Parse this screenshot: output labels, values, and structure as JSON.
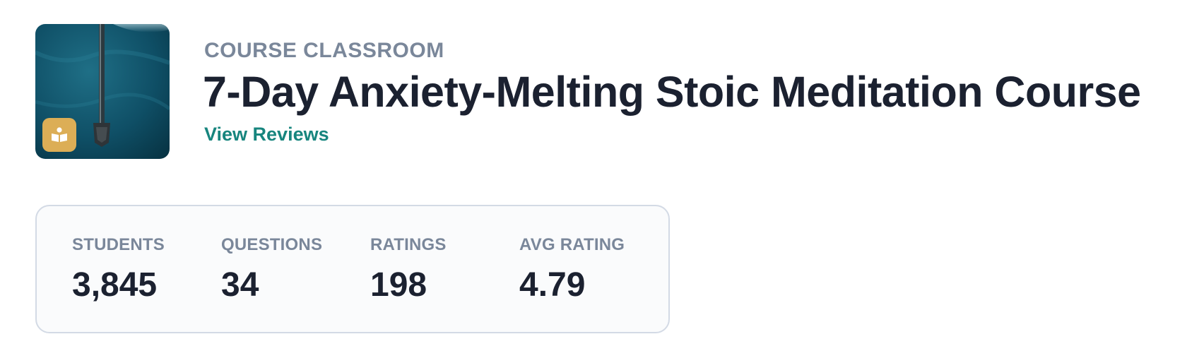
{
  "header": {
    "eyebrow": "COURSE CLASSROOM",
    "title": "7-Day Anxiety-Melting Stoic Meditation Course",
    "reviews_link": "View Reviews"
  },
  "thumbnail": {
    "badge_icon": "book-reader-icon",
    "badge_color": "#dcae56"
  },
  "stats": [
    {
      "label": "STUDENTS",
      "value": "3,845"
    },
    {
      "label": "QUESTIONS",
      "value": "34"
    },
    {
      "label": "RATINGS",
      "value": "198"
    },
    {
      "label": "AVG RATING",
      "value": "4.79"
    }
  ],
  "colors": {
    "accent_link": "#17857e",
    "heading": "#1b2130",
    "muted": "#7a879a",
    "card_border": "#d3dae5"
  }
}
